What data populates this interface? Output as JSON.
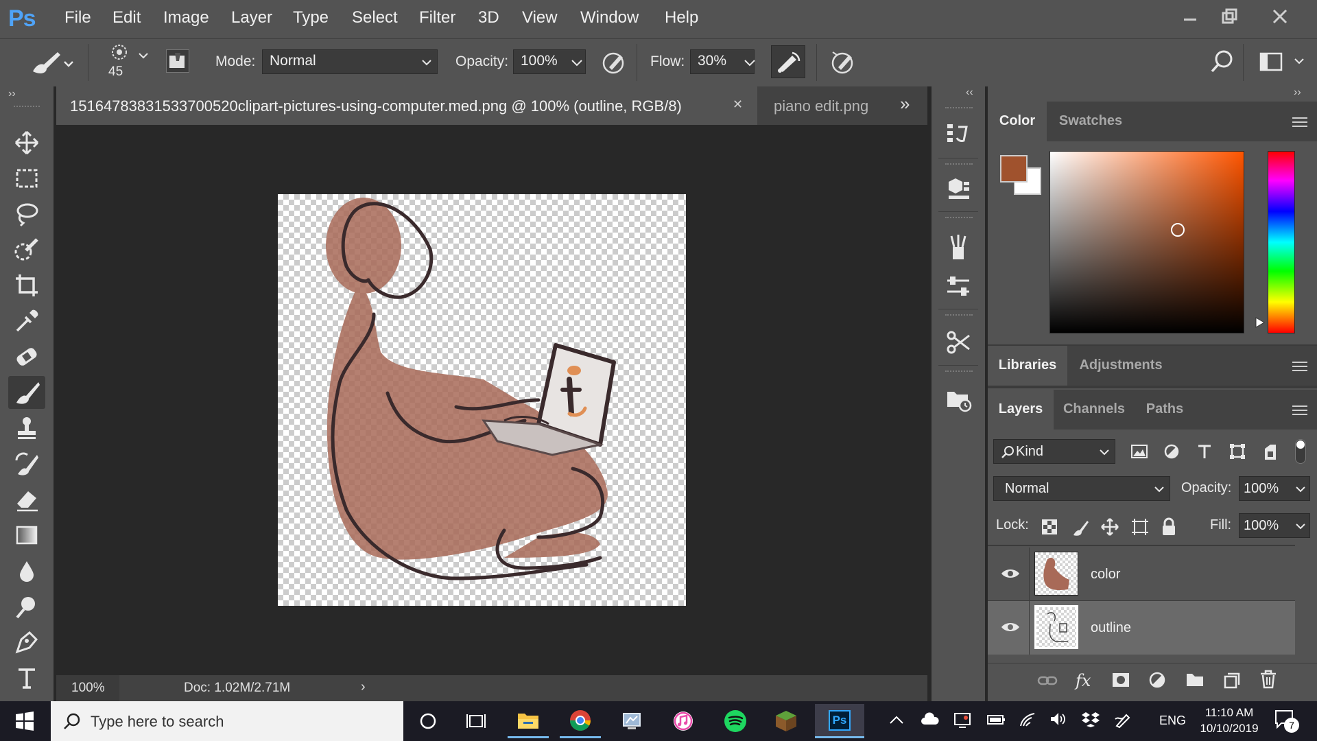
{
  "app": {
    "logo": "Ps"
  },
  "menu": [
    "File",
    "Edit",
    "Image",
    "Layer",
    "Type",
    "Select",
    "Filter",
    "3D",
    "View",
    "Window",
    "Help"
  ],
  "options": {
    "brush_size": "45",
    "mode_label": "Mode:",
    "mode_value": "Normal",
    "opacity_label": "Opacity:",
    "opacity_value": "100%",
    "flow_label": "Flow:",
    "flow_value": "30%"
  },
  "document": {
    "active_tab": "1516478383153370052 0clipart-pictures-using-computer.med.png @ 100% (outline, RGB/8)",
    "active_tab_display": "15164783831533700520clipart-pictures-using-computer.med.png @ 100% (outline, RGB/8)",
    "second_tab": "piano edit.png",
    "zoom": "100%",
    "doc_size": "Doc: 1.02M/2.71M"
  },
  "color_panel": {
    "tabs": [
      "Color",
      "Swatches"
    ],
    "foreground_color": "#a0522d",
    "background_color": "#ffffff",
    "hue_base": "#ff5500"
  },
  "libraries_panel": {
    "tabs": [
      "Libraries",
      "Adjustments"
    ]
  },
  "layers_panel": {
    "tabs": [
      "Layers",
      "Channels",
      "Paths"
    ],
    "kind_label": "Kind",
    "blend_mode": "Normal",
    "opacity_label": "Opacity:",
    "opacity_value": "100%",
    "lock_label": "Lock:",
    "fill_label": "Fill:",
    "fill_value": "100%",
    "layers": [
      {
        "name": "color",
        "visible": true,
        "selected": false
      },
      {
        "name": "outline",
        "visible": true,
        "selected": true
      }
    ]
  },
  "taskbar": {
    "search_placeholder": "Type here to search",
    "language": "ENG",
    "time": "11:10 AM",
    "date": "10/10/2019",
    "notification_count": "7"
  }
}
